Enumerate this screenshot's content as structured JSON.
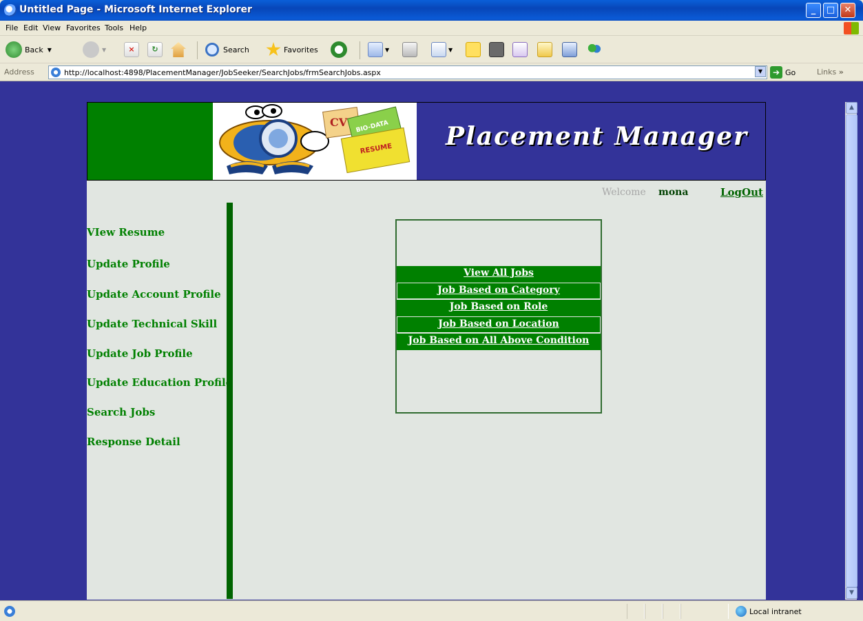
{
  "window": {
    "title": "Untitled Page - Microsoft Internet Explorer",
    "buttons": {
      "minimize": "_",
      "maximize": "□",
      "close": "✕"
    }
  },
  "menu": [
    "File",
    "Edit",
    "View",
    "Favorites",
    "Tools",
    "Help"
  ],
  "toolbar": {
    "back_label": "Back",
    "search_label": "Search",
    "favorites_label": "Favorites"
  },
  "address": {
    "label": "Address",
    "url": "http://localhost:4898/PlacementManager/JobSeeker/SearchJobs/frmSearchJobs.aspx",
    "go_label": "Go",
    "links_label": "Links"
  },
  "page": {
    "banner_title": "Placement Manager",
    "banner_image_words": [
      "CV",
      "BIO-DATA",
      "RESUME"
    ],
    "welcome_text": "Welcome",
    "username": "mona",
    "logout_label": "LogOut",
    "sidebar": [
      {
        "label": "VIew Resume"
      },
      {
        "label": "Update Profile"
      },
      {
        "label": "Update Account Profile"
      },
      {
        "label": "Update Technical Skill"
      },
      {
        "label": "Update Job Profile"
      },
      {
        "label": "Update Education Profile"
      },
      {
        "label": "Search Jobs"
      },
      {
        "label": "Response Detail"
      }
    ],
    "job_links": [
      {
        "label": "View All Jobs"
      },
      {
        "label": "Job Based on Category"
      },
      {
        "label": "Job Based on Role"
      },
      {
        "label": "Job Based on Location"
      },
      {
        "label": "Job Based on All Above Condition"
      }
    ]
  },
  "status": {
    "zone": "Local intranet"
  },
  "colors": {
    "page_background": "#333399",
    "content_background": "#e1e6e1",
    "accent_green": "#008000",
    "dark_green": "#006400"
  },
  "icons": [
    "ie-icon",
    "back-icon",
    "forward-icon",
    "stop-icon",
    "refresh-icon",
    "home-icon",
    "search-icon",
    "favorites-icon",
    "history-icon",
    "mail-icon",
    "print-icon",
    "edit-icon",
    "discuss-icon",
    "messenger-icon",
    "go-icon",
    "local-intranet-icon"
  ]
}
